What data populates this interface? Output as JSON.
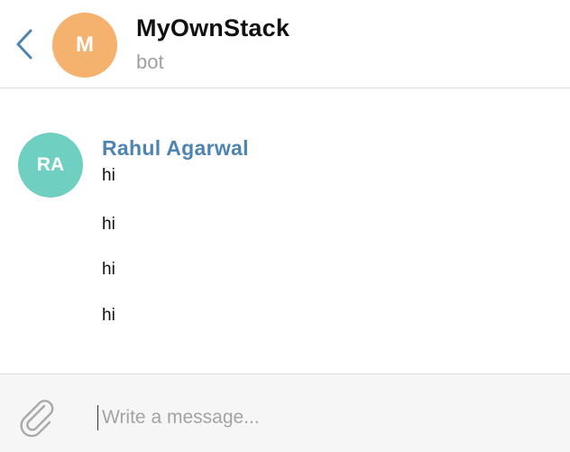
{
  "header": {
    "chat_avatar_initial": "M",
    "chat_title": "MyOwnStack",
    "chat_subtitle": "bot",
    "back_icon": "chevron-left-icon",
    "accent_color": "#4d84b2",
    "avatar_color": "#f5b16e"
  },
  "messages": {
    "sender": {
      "initials": "RA",
      "name": "Rahul Agarwal",
      "avatar_color": "#6fcfc0",
      "name_color": "#4d84b2"
    },
    "items": [
      {
        "text": "hi"
      },
      {
        "text": "hi"
      },
      {
        "text": "hi"
      },
      {
        "text": "hi"
      }
    ]
  },
  "composer": {
    "attach_icon": "paperclip-icon",
    "placeholder": "Write a message...",
    "value": ""
  }
}
